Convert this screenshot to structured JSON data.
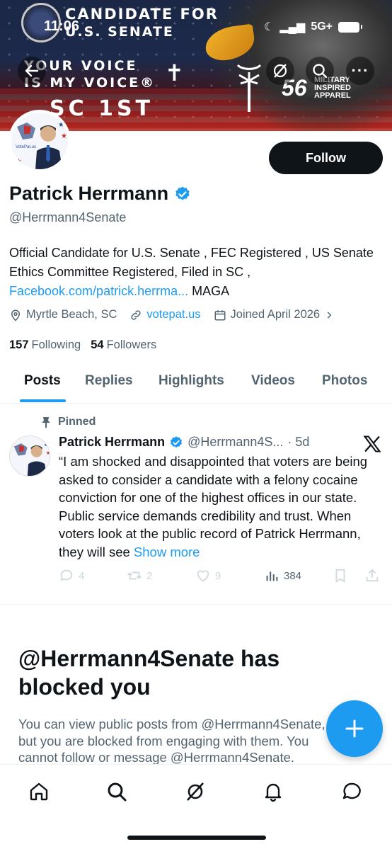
{
  "status_bar": {
    "time": "11:06",
    "network": "5G+"
  },
  "banner": {
    "line1": "CANDIDATE FOR",
    "line2": "U.S. SENATE",
    "line3": "YOUR VOICE",
    "line4": "IS MY VOICE®",
    "line5": "SC 1ST",
    "badge_number": "56",
    "badge_text": "MILITARY INSPIRED APPAREL"
  },
  "profile": {
    "display_name": "Patrick Herrmann",
    "handle": "@Herrmann4Senate",
    "follow_label": "Follow",
    "bio_text": "Official Candidate for U.S. Senate , FEC Registered , US Senate Ethics Committee Registered, Filed in SC ,",
    "bio_link": "Facebook.com/patrick.herrma...",
    "bio_suffix": " MAGA",
    "location": "Myrtle Beach, SC",
    "website": "votepat.us",
    "joined": "Joined April 2026",
    "following_count": "157",
    "following_label": "Following",
    "followers_count": "54",
    "followers_label": "Followers"
  },
  "tabs": [
    "Posts",
    "Replies",
    "Highlights",
    "Videos",
    "Photos"
  ],
  "post": {
    "pinned_label": "Pinned",
    "author": "Patrick Herrmann",
    "handle": "@Herrmann4S...",
    "time": "· 5d",
    "text": "“I am shocked and disappointed that voters are being asked to consider a candidate with a felony cocaine conviction for one of the highest offices in our state. Public service demands credibility and trust. When voters look at the public record of Patrick Herrmann, they will see",
    "show_more": "Show more",
    "replies": "4",
    "reposts": "2",
    "likes": "9",
    "views": "384"
  },
  "blocked": {
    "title": "@Herrmann4Senate has blocked you",
    "line1": "You can view public posts from @Herrmann4Senate,",
    "line2": "but you are blocked from engaging with them. You",
    "line3": "cannot follow or message @Herrmann4Senate."
  },
  "colors": {
    "accent": "#1d9bf0",
    "text": "#0f1419",
    "muted": "#536471"
  }
}
